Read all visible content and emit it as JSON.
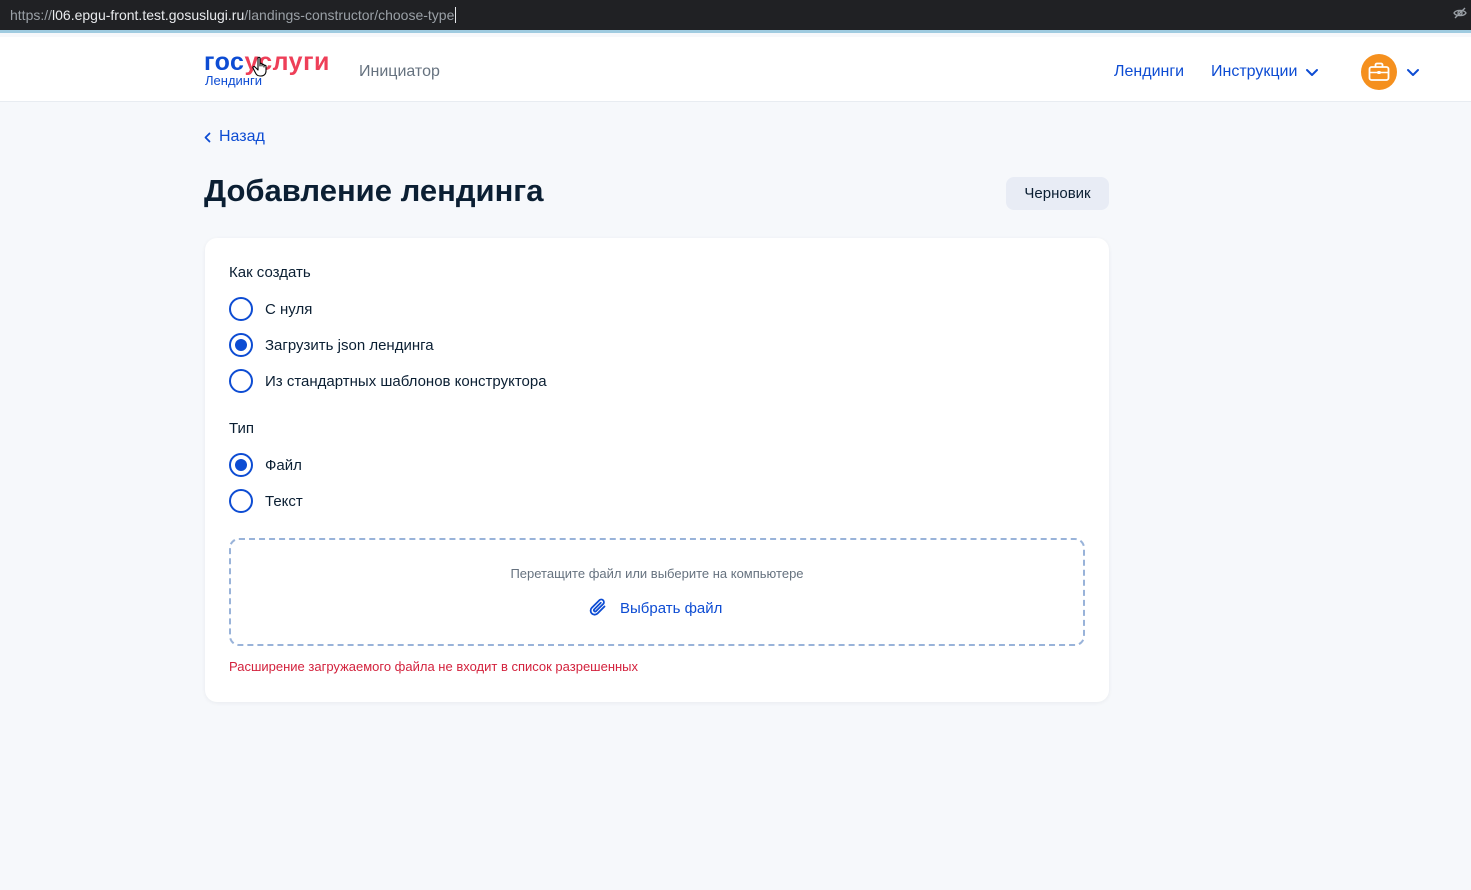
{
  "browser": {
    "url_prefix": "https://",
    "url_domain": "l06.epgu-front.test.gosuslugi.ru",
    "url_path": "/landings-constructor/choose-type"
  },
  "header": {
    "logo_gos": "гос",
    "logo_uslugi": "услуги",
    "logo_sub": "Лендинги",
    "role": "Инициатор",
    "nav_landings": "Лендинги",
    "nav_instructions": "Инструкции"
  },
  "page": {
    "back": "Назад",
    "title": "Добавление лендинга",
    "status": "Черновик"
  },
  "form": {
    "how_label": "Как создать",
    "how_options": [
      {
        "label": "С нуля",
        "checked": false
      },
      {
        "label": "Загрузить json лендинга",
        "checked": true
      },
      {
        "label": "Из стандартных шаблонов конструктора",
        "checked": false
      }
    ],
    "type_label": "Тип",
    "type_options": [
      {
        "label": "Файл",
        "checked": true
      },
      {
        "label": "Текст",
        "checked": false
      }
    ],
    "dropzone_hint": "Перетащите файл или выберите на компьютере",
    "choose_file": "Выбрать файл",
    "error": "Расширение загружаемого файла не входит в список разрешенных"
  },
  "colors": {
    "accent": "#0d4cd3",
    "brand_red": "#ee3f58",
    "error": "#d3223d",
    "avatar": "#f5901e"
  }
}
